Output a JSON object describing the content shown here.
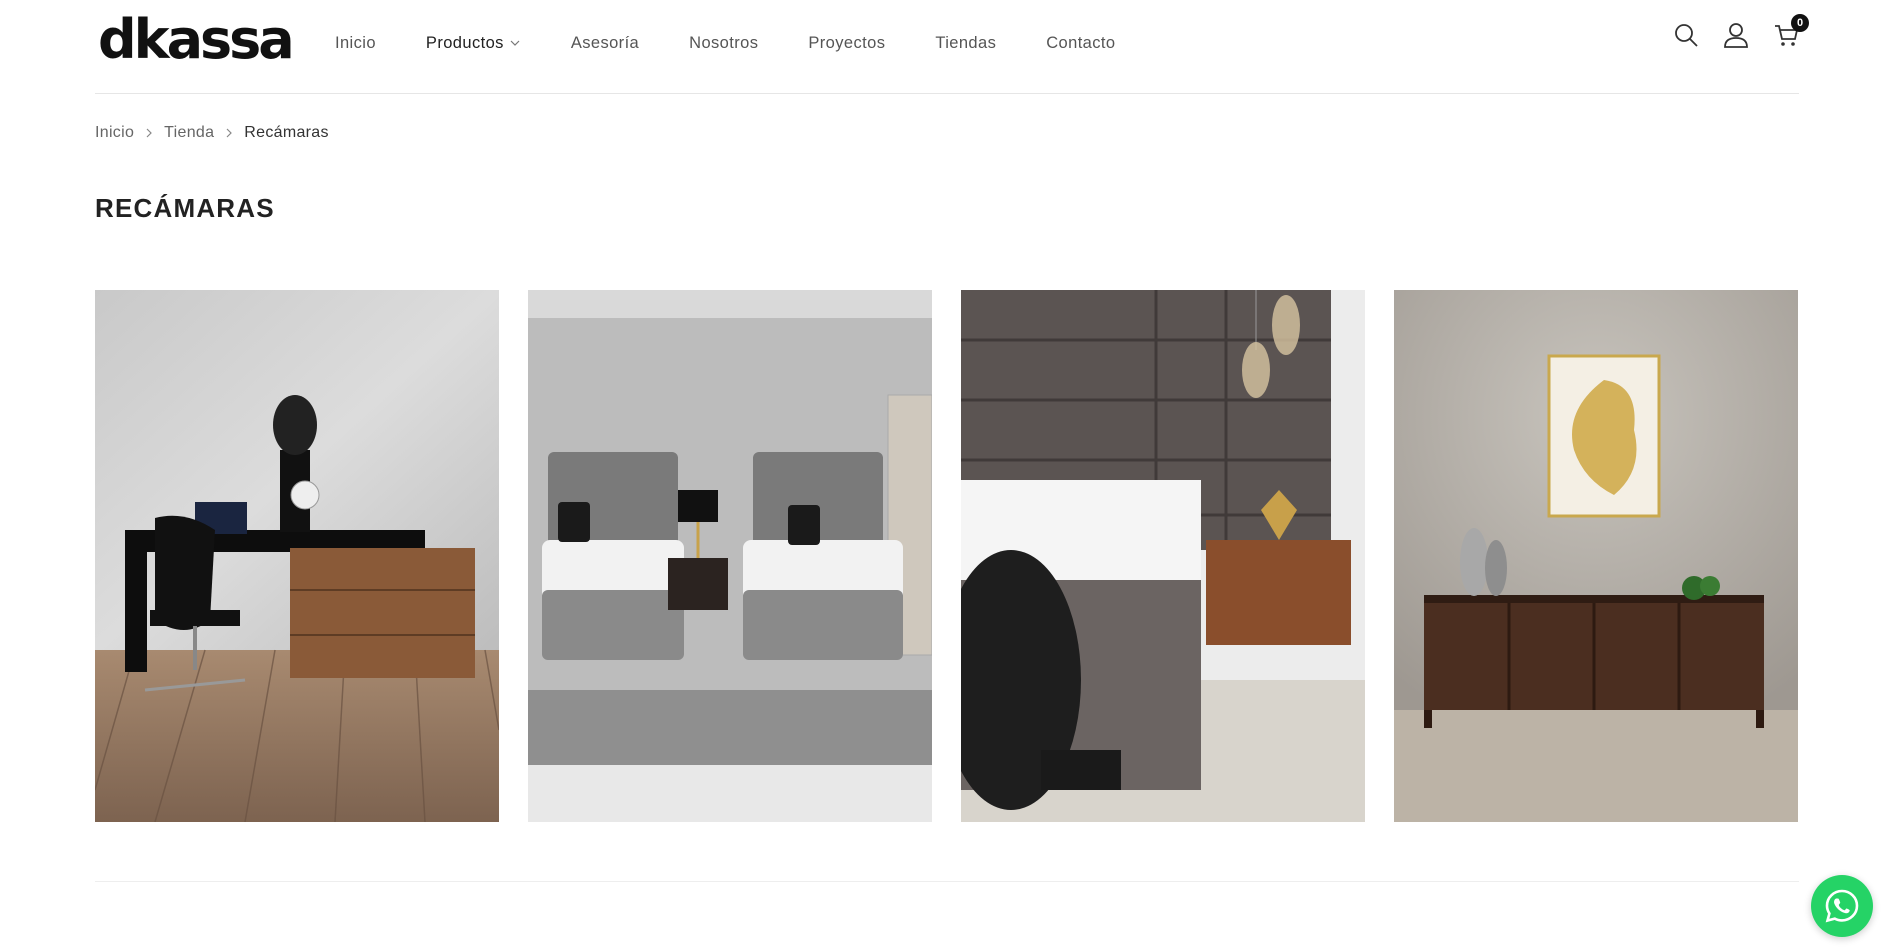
{
  "brand": {
    "logo_text": "dkassa"
  },
  "nav": {
    "items": [
      {
        "label": "Inicio"
      },
      {
        "label": "Productos"
      },
      {
        "label": "Asesoría"
      },
      {
        "label": "Nosotros"
      },
      {
        "label": "Proyectos"
      },
      {
        "label": "Tiendas"
      },
      {
        "label": "Contacto"
      }
    ]
  },
  "header_icons": [
    "search-icon",
    "user-icon",
    "cart-icon"
  ],
  "cart": {
    "count": "0"
  },
  "breadcrumb": {
    "items": [
      {
        "label": "Inicio"
      },
      {
        "label": "Tienda"
      },
      {
        "label": "Recámaras"
      }
    ]
  },
  "page": {
    "title": "RECÁMARAS"
  },
  "products": [
    {
      "image": "desk-with-office-chair-and-lamp"
    },
    {
      "image": "twin-grey-upholstered-beds-with-rug"
    },
    {
      "image": "grey-tufted-headboard-bed-with-pendant-lamps"
    },
    {
      "image": "wood-sideboard-with-vases-and-wall-art"
    }
  ],
  "colors": {
    "whatsapp": "#25d366",
    "text": "#222222",
    "muted": "#666666"
  }
}
